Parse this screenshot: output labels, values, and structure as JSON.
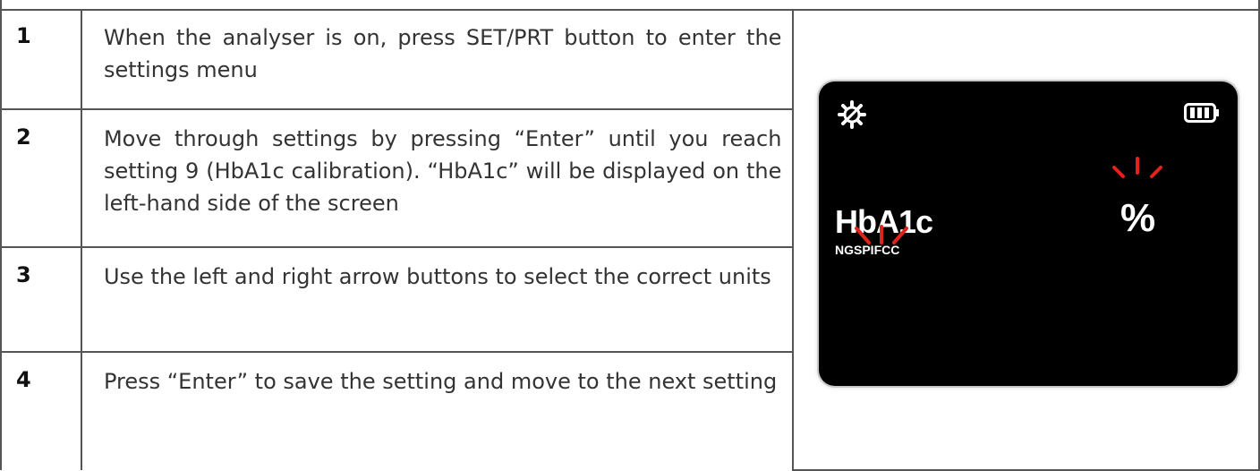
{
  "steps": [
    {
      "number": "1",
      "text": "When the analyser is on, press SET/PRT button to enter the settings menu"
    },
    {
      "number": "2",
      "text": "Move through settings by pressing “Enter” until you reach setting 9 (HbA1c calibration). “HbA1c” will be displayed on the left-hand side of the screen"
    },
    {
      "number": "3",
      "text": "Use the left and right arrow buttons to select the correct units"
    },
    {
      "number": "4",
      "text": "Press “Enter” to save the setting and move to the next setting"
    }
  ],
  "display": {
    "label": "HbA1c",
    "units_label": "NGSPIFCC",
    "unit_symbol": "%",
    "icons": [
      "gear-icon",
      "battery-icon"
    ],
    "flash_color": "#e0231b"
  }
}
